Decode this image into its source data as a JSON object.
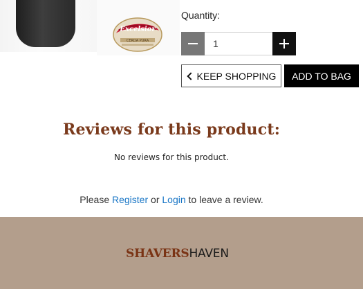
{
  "product": {
    "thumbnail": {
      "brand_mark": "Excelsior",
      "tagline": "CERDA PURA"
    }
  },
  "purchase": {
    "quantity_label": "Quantity:",
    "quantity_value": "1",
    "keep_shopping_label": "KEEP SHOPPING",
    "add_to_bag_label": "ADD TO BAG"
  },
  "reviews": {
    "heading": "Reviews for this product:",
    "empty_message": "No reviews for this product.",
    "prompt_before": "Please",
    "register_link": "Register",
    "prompt_middle": "or",
    "login_link": "Login",
    "prompt_after": "to leave a review."
  },
  "footer": {
    "logo_part1": "SHAVERS",
    "logo_part2": "HAVEN"
  },
  "colors": {
    "heading": "#7a3a1c",
    "link": "#1976c6",
    "footer_bg": "#b39e8c",
    "logo_part1": "#7a3314",
    "add_to_bag_bg": "#000000",
    "minus_bg": "#777777"
  },
  "icons": {
    "minus": "minus-icon",
    "plus": "plus-icon",
    "keep_shopping": "chevron-left-icon"
  }
}
